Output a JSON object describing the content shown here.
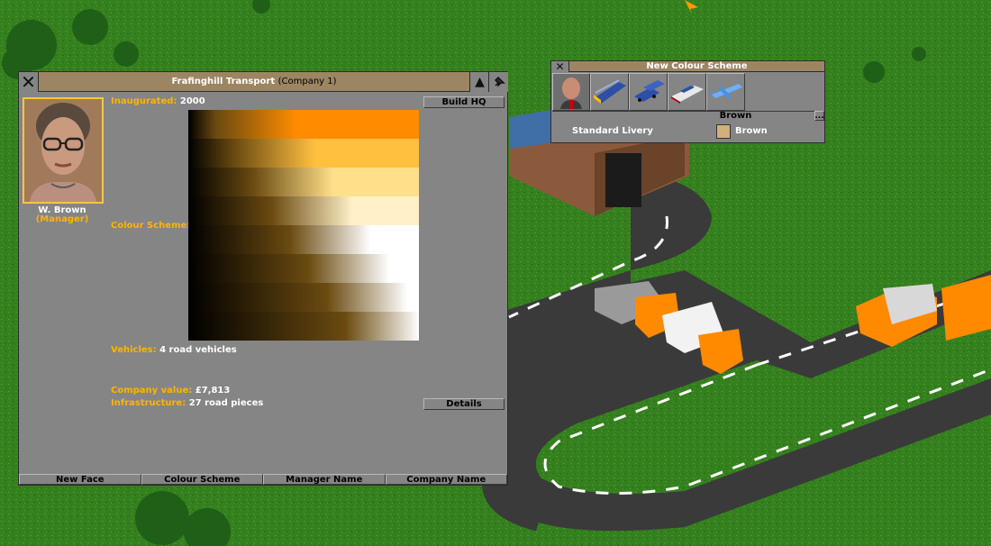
{
  "company_window": {
    "title_company": "Frafinghill Transport",
    "title_number": "(Company 1)",
    "inaugurated_label": "Inaugurated:",
    "inaugurated_value": "2000",
    "build_hq_label": "Build HQ",
    "manager_name": "W. Brown",
    "manager_role": "(Manager)",
    "colour_scheme_label": "Colour Scheme:",
    "vehicles_label": "Vehicles:",
    "vehicles_value": "4 road vehicles",
    "company_value_label": "Company value:",
    "company_value_value": "£7,813",
    "infrastructure_label": "Infrastructure:",
    "infrastructure_value": "27 road pieces",
    "details_label": "Details",
    "buttons": [
      "New Face",
      "Colour Scheme",
      "Manager Name",
      "Company Name"
    ]
  },
  "colour_window": {
    "title": "New Colour Scheme",
    "tabs": [
      "manager-face-tab",
      "train-tab",
      "road-vehicle-tab",
      "ship-tab",
      "aircraft-tab"
    ],
    "selected_colour": "Brown",
    "more_label": "...",
    "livery_row_label": "Standard Livery",
    "livery_row_colour": "Brown"
  },
  "colors": {
    "window_bg": "#858585",
    "title_bar": "#9c8562",
    "label_orange": "#ffb400",
    "company_orange": "#ff9000",
    "brown_swatch": "#d0b07c"
  }
}
